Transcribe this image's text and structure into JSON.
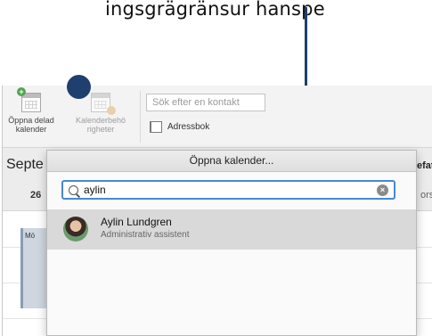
{
  "callout": {
    "text": "ingsgrägränsur hanspe"
  },
  "ribbon": {
    "open_shared_calendar_label": "Öppna delad kalender",
    "calendar_permissions_label": "Kalenderbehö righeter",
    "search_contact_placeholder": "Sök efter en kontakt",
    "address_book_label": "Adressbok"
  },
  "calendar": {
    "month_partial": "Septe",
    "day_26": "26",
    "right_header_partial": "efat",
    "right_sub_partial": "ors",
    "event_label": "Mö"
  },
  "dialog": {
    "title": "Öppna kalender...",
    "search_value": "aylin",
    "result": {
      "name": "Aylin Lundgren",
      "title": "Administrativ assistent"
    }
  },
  "colors": {
    "callout": "#1f3f6e",
    "search_focus": "#4a86d8",
    "selected_row": "#d9d9d9"
  }
}
